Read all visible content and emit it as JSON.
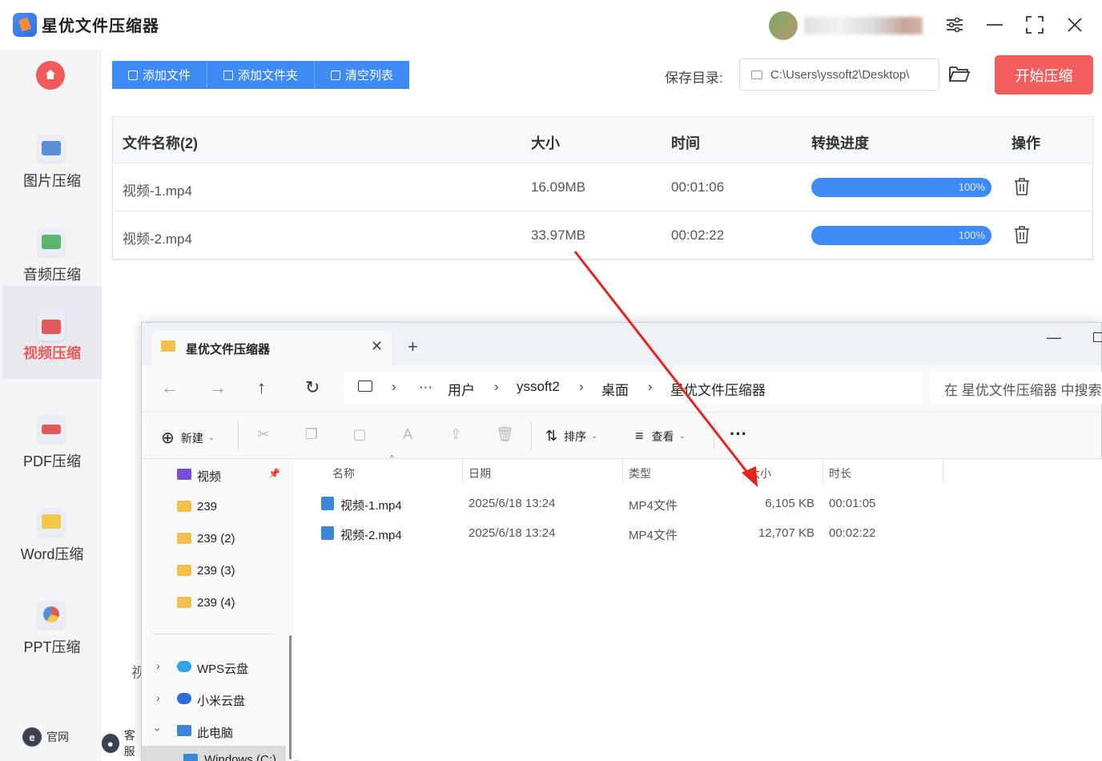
{
  "app": {
    "title": "星优文件压缩器",
    "save_label": "保存目录:",
    "save_path": "C:\\Users\\yssoft2\\Desktop\\",
    "start_button": "开始压缩",
    "toolbar": {
      "add_file": "添加文件",
      "add_folder": "添加文件夹",
      "clear_list": "清空列表"
    },
    "sidebar": {
      "items": [
        {
          "label": "图片压缩",
          "icon": "image-icon"
        },
        {
          "label": "音频压缩",
          "icon": "music-icon"
        },
        {
          "label": "视频压缩",
          "icon": "video-icon"
        },
        {
          "label": "PDF压缩",
          "icon": "pdf-icon"
        },
        {
          "label": "Word压缩",
          "icon": "word-icon"
        },
        {
          "label": "PPT压缩",
          "icon": "ppt-icon"
        }
      ],
      "bottom": {
        "website": "官网",
        "service": "客服"
      }
    },
    "table": {
      "headers": [
        "文件名称(2)",
        "大小",
        "时间",
        "转换进度",
        "操作"
      ],
      "rows": [
        {
          "name": "视频-1.mp4",
          "size": "16.09MB",
          "time": "00:01:06",
          "progress": "100%"
        },
        {
          "name": "视频-2.mp4",
          "size": "33.97MB",
          "time": "00:02:22",
          "progress": "100%"
        }
      ]
    },
    "hidden_text": "视"
  },
  "explorer": {
    "tab_title": "星优文件压缩器",
    "breadcrumb": [
      "用户",
      "yssoft2",
      "桌面",
      "星优文件压缩器"
    ],
    "search_placeholder": "在 星优文件压缩器 中搜索",
    "commands": {
      "new": "新建",
      "sort": "排序",
      "view": "查看"
    },
    "tree": [
      {
        "label": "视频"
      },
      {
        "label": "239"
      },
      {
        "label": "239 (2)"
      },
      {
        "label": "239 (3)"
      },
      {
        "label": "239 (4)"
      },
      {
        "label": "WPS云盘"
      },
      {
        "label": "小米云盘"
      },
      {
        "label": "此电脑"
      },
      {
        "label": "Windows (C:)"
      }
    ],
    "columns": [
      "名称",
      "日期",
      "类型",
      "大小",
      "时长"
    ],
    "files": [
      {
        "name": "视频-1.mp4",
        "date": "2025/6/18 13:24",
        "type": "MP4文件",
        "size": "6,105 KB",
        "duration": "00:01:05"
      },
      {
        "name": "视频-2.mp4",
        "date": "2025/6/18 13:24",
        "type": "MP4文件",
        "size": "12,707 KB",
        "duration": "00:02:22"
      }
    ]
  },
  "colors": {
    "accent_blue": "#3f8bf5",
    "accent_red": "#f25e5e",
    "arrow_red": "#e8231f"
  }
}
